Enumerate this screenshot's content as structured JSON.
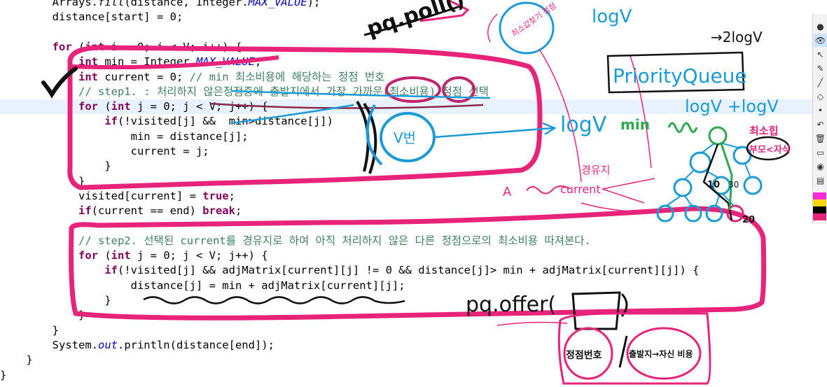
{
  "code": {
    "lines": [
      {
        "indent": "        ",
        "tokens": [
          {
            "t": "Arrays."
          },
          {
            "t": "fill",
            "c": "fi"
          },
          {
            "t": "(distance, Integer."
          },
          {
            "t": "MAX_VALUE",
            "c": "st"
          },
          {
            "t": ");"
          }
        ]
      },
      {
        "indent": "        ",
        "tokens": [
          {
            "t": "distance[start] = 0;"
          }
        ]
      },
      {
        "indent": "",
        "tokens": []
      },
      {
        "indent": "        ",
        "tokens": [
          {
            "t": "for",
            "c": "kw"
          },
          {
            "t": " ("
          },
          {
            "t": "int",
            "c": "kw"
          },
          {
            "t": " i = 0; i < V; i++) {"
          }
        ]
      },
      {
        "indent": "            ",
        "tokens": [
          {
            "t": "int",
            "c": "kw"
          },
          {
            "t": " min = Integer."
          },
          {
            "t": "MAX_VALUE",
            "c": "st"
          },
          {
            "t": ";"
          }
        ]
      },
      {
        "indent": "            ",
        "tokens": [
          {
            "t": "int",
            "c": "kw"
          },
          {
            "t": " current = 0; "
          },
          {
            "t": "// min 최소비용에 해당하는 정점 번호",
            "c": "cm"
          }
        ]
      },
      {
        "indent": "            ",
        "tokens": [
          {
            "t": "// step1. : 처리하지 않은정점중에 출발지에서 가장 가까운(최소비용) 정점 선택",
            "c": "cm"
          }
        ]
      },
      {
        "indent": "            ",
        "tokens": [
          {
            "t": "for",
            "c": "kw"
          },
          {
            "t": " ("
          },
          {
            "t": "int",
            "c": "kw"
          },
          {
            "t": " j = 0; j < V; j++) {"
          }
        ]
      },
      {
        "indent": "                ",
        "tokens": [
          {
            "t": "if",
            "c": "kw"
          },
          {
            "t": "(!visited[j] &&  min>distance[j])"
          }
        ]
      },
      {
        "indent": "                    ",
        "tokens": [
          {
            "t": "min = distance[j];"
          }
        ]
      },
      {
        "indent": "                    ",
        "tokens": [
          {
            "t": "current = j;"
          }
        ]
      },
      {
        "indent": "                ",
        "tokens": [
          {
            "t": "}"
          }
        ]
      },
      {
        "indent": "            ",
        "tokens": [
          {
            "t": "}"
          }
        ]
      },
      {
        "indent": "            ",
        "tokens": [
          {
            "t": "visited[current] = "
          },
          {
            "t": "true",
            "c": "kw"
          },
          {
            "t": ";"
          }
        ]
      },
      {
        "indent": "            ",
        "tokens": [
          {
            "t": "if",
            "c": "kw"
          },
          {
            "t": "(current == end) "
          },
          {
            "t": "break",
            "c": "kw"
          },
          {
            "t": ";"
          }
        ]
      },
      {
        "indent": "",
        "tokens": []
      },
      {
        "indent": "            ",
        "tokens": [
          {
            "t": "// step2. 선택된 current를 경유지로 하여 아직 처리하지 않은 다른 정점으로의 최소비용 따져본다.",
            "c": "cm"
          }
        ]
      },
      {
        "indent": "            ",
        "tokens": [
          {
            "t": "for",
            "c": "kw"
          },
          {
            "t": " ("
          },
          {
            "t": "int",
            "c": "kw"
          },
          {
            "t": " j = 0; j < V; j++) {"
          }
        ]
      },
      {
        "indent": "                ",
        "tokens": [
          {
            "t": "if",
            "c": "kw"
          },
          {
            "t": "(!visited[j] && adjMatrix[current][j] != 0 && distance[j]> min + adjMatrix[current][j]) {"
          }
        ]
      },
      {
        "indent": "                    ",
        "tokens": [
          {
            "t": "distance[j] = min + adjMatrix[current][j];"
          }
        ]
      },
      {
        "indent": "                ",
        "tokens": [
          {
            "t": "}"
          }
        ]
      },
      {
        "indent": "            ",
        "tokens": [
          {
            "t": "}"
          }
        ]
      },
      {
        "indent": "        ",
        "tokens": [
          {
            "t": "}"
          }
        ]
      },
      {
        "indent": "        ",
        "tokens": [
          {
            "t": "System."
          },
          {
            "t": "out",
            "c": "fld"
          },
          {
            "t": ".println(distance[end]);"
          }
        ]
      },
      {
        "indent": "    ",
        "tokens": [
          {
            "t": "}"
          }
        ]
      },
      {
        "indent": "",
        "tokens": [
          {
            "t": "}"
          }
        ]
      }
    ],
    "highlighted_line": 7
  },
  "annotations": {
    "pq_poll": "pq.poll()",
    "logV_top": "logV",
    "two_logV": "→2logV",
    "priority_queue": "PriorityQueue",
    "logV_tlogV": "logV +logV",
    "logV_mid": "logV",
    "min_label": "min",
    "V_beon": "V번",
    "choso_label": "최소값찾기 정점",
    "gyeongyuji": "경유지",
    "current_label": "current",
    "A_label": "A",
    "choegap": "최소힙",
    "bumo_jasik": "부모<자식",
    "pq_offer": "pq.offer(",
    "jeongjeom_beonho": "정점번호",
    "chulbalji_biyong": "출발지→자신 비용",
    "num_10": "10",
    "num_20": "20",
    "num_30": "30"
  },
  "toolbar": {
    "items": [
      {
        "name": "pin-icon",
        "glyph": "●"
      },
      {
        "name": "eye-icon",
        "glyph": "👁"
      },
      {
        "name": "cursor-icon",
        "glyph": "↖"
      },
      {
        "name": "highlighter-icon",
        "glyph": "✎"
      },
      {
        "name": "pen-icon",
        "glyph": "╱"
      },
      {
        "name": "eraser-icon",
        "glyph": "◇"
      },
      {
        "name": "dot-icon",
        "glyph": "•"
      },
      {
        "name": "undo-icon",
        "glyph": "↶"
      },
      {
        "name": "trash-icon",
        "glyph": "🗑"
      },
      {
        "name": "whiteboard-icon",
        "glyph": "▭"
      },
      {
        "name": "camera-icon",
        "glyph": "◉"
      },
      {
        "name": "clipboard-icon",
        "glyph": "▤"
      }
    ],
    "active_index": 1
  },
  "colors": {
    "ink_pink": "#e8247a",
    "ink_blue": "#1a9bd7",
    "ink_green": "#2aa84a",
    "ink_black": "#111111",
    "ink_purple": "#8a2a4a",
    "palette": [
      "#ff2bd6",
      "#ffd400",
      "#000000",
      "#e8247a"
    ]
  }
}
